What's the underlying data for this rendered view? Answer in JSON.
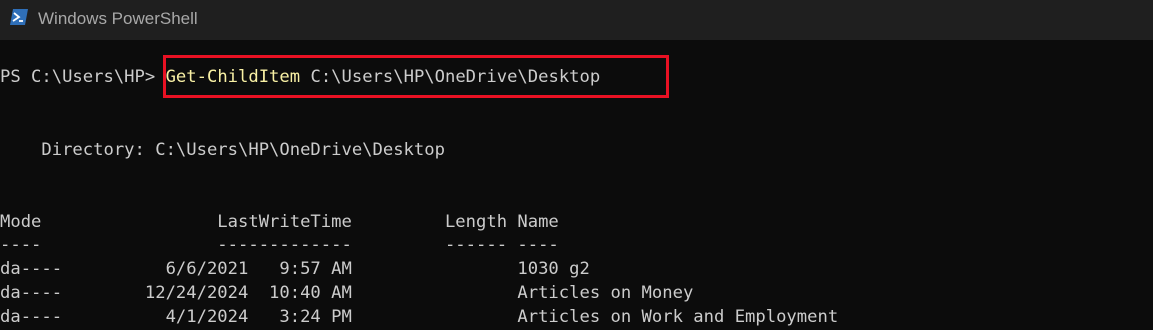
{
  "window": {
    "title": "Windows PowerShell",
    "icon": "powershell-icon"
  },
  "prompt": {
    "text": "PS C:\\Users\\HP>",
    "command": "Get-ChildItem",
    "argument": "C:\\Users\\HP\\OneDrive\\Desktop"
  },
  "directory_line": "    Directory: C:\\Users\\HP\\OneDrive\\Desktop",
  "table": {
    "header": "Mode                 LastWriteTime         Length Name",
    "separator": "----                 -------------         ------ ----",
    "rows": [
      "da----          6/6/2021   9:57 AM                1030 g2",
      "da----        12/24/2024  10:40 AM                Articles on Money",
      "da----          4/1/2024   3:24 PM                Articles on Work and Employment"
    ]
  },
  "colors": {
    "background": "#0c0c0c",
    "text": "#cccccc",
    "cmdlet": "#f9f1a5",
    "highlight": "#e81123",
    "titlebar": "#1f1f1f"
  }
}
